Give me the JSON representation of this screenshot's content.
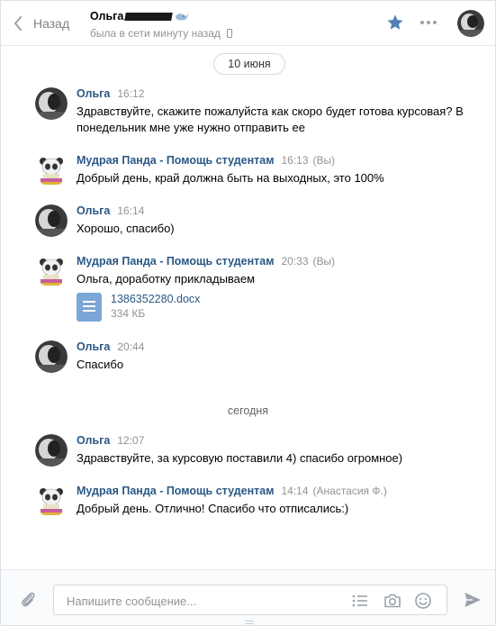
{
  "header": {
    "back_label": "Назад",
    "peer_name": "Ольга",
    "peer_status": "была в сети минуту назад"
  },
  "chat": {
    "date_divider": "10 июня",
    "today_divider": "сегодня",
    "messages": [
      {
        "author": "Ольга",
        "time": "16:12",
        "note": "",
        "text": "Здравствуйте, скажите пожалуйста как скоро будет готова курсовая? В понедельник мне уже нужно отправить ее"
      },
      {
        "author": "Мудрая Панда - Помощь студентам",
        "time": "16:13",
        "note": "(Вы)",
        "text": "Добрый день, край должна быть на выходных, это 100%"
      },
      {
        "author": "Ольга",
        "time": "16:14",
        "note": "",
        "text": "Хорошо, спасибо)"
      },
      {
        "author": "Мудрая Панда - Помощь студентам",
        "time": "20:33",
        "note": "(Вы)",
        "text": "Ольга, доработку прикладываем",
        "attachment": {
          "name": "1386352280.docx",
          "size": "334 КБ",
          "icon": "document-icon"
        }
      },
      {
        "author": "Ольга",
        "time": "20:44",
        "note": "",
        "text": "Спасибо"
      },
      {
        "author": "Ольга",
        "time": "12:07",
        "note": "",
        "text": "Здравствуйте, за курсовую поставили 4) спасибо огромное)"
      },
      {
        "author": "Мудрая Панда - Помощь студентам",
        "time": "14:14",
        "note": "(Анастасия Ф.)",
        "text": "Добрый день. Отлично! Спасибо что отписались:)"
      }
    ]
  },
  "composer": {
    "placeholder": "Напишите сообщение...",
    "value": ""
  },
  "colors": {
    "link": "#2a5885",
    "star": "#5181b8",
    "muted": "#939393",
    "doc_icon": "#7ba6d6"
  },
  "icons": [
    "back-chevron-icon",
    "whale-icon",
    "phone-icon",
    "star-icon",
    "more-icon",
    "paperclip-icon",
    "list-icon",
    "camera-icon",
    "emoji-icon",
    "send-icon"
  ]
}
